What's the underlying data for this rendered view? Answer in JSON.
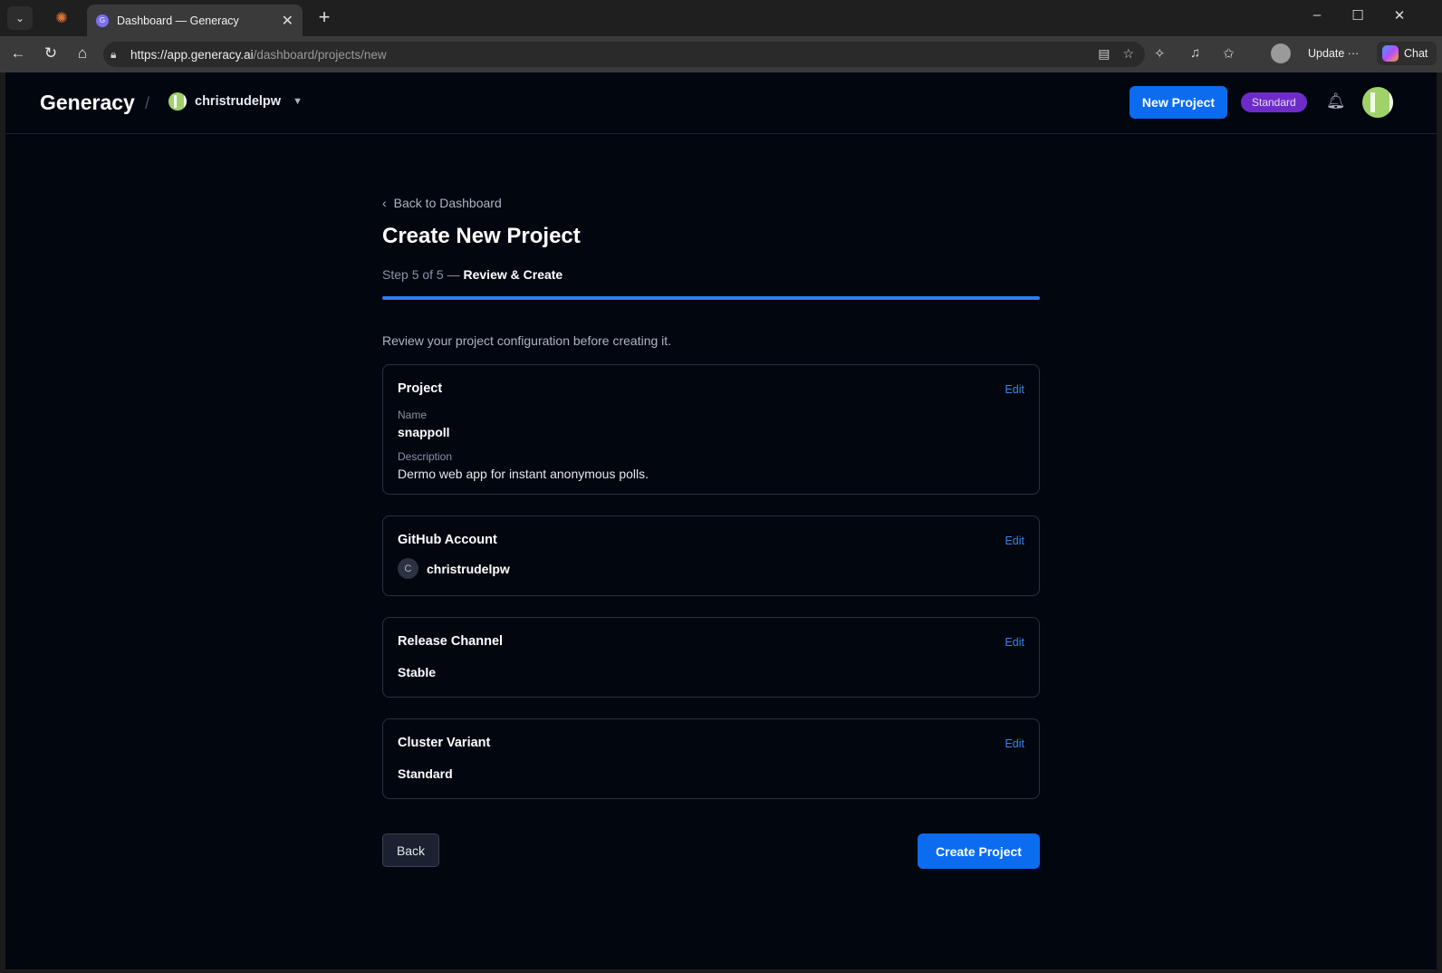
{
  "browser": {
    "tab_title": "Dashboard — Generacy",
    "tab_favicon_letter": "G",
    "url_host": "https://app.generacy.ai",
    "url_path": "/dashboard/projects/new",
    "update_label": "Update",
    "chat_label": "Chat"
  },
  "header": {
    "brand": "Generacy",
    "org_name": "christrudelpw",
    "new_project_label": "New Project",
    "plan_badge": "Standard"
  },
  "page": {
    "back_link": "Back to Dashboard",
    "title": "Create New Project",
    "step_prefix": "Step 5 of 5 — ",
    "step_name": "Review & Create",
    "progress_fraction": 1.0,
    "intro": "Review your project configuration before creating it."
  },
  "cards": {
    "project": {
      "title": "Project",
      "edit_label": "Edit",
      "name_label": "Name",
      "name_value": "snappoll",
      "description_label": "Description",
      "description_value": "Dermo web app for instant anonymous polls."
    },
    "github": {
      "title": "GitHub Account",
      "edit_label": "Edit",
      "avatar_letter": "C",
      "account_name": "christrudelpw"
    },
    "release": {
      "title": "Release Channel",
      "edit_label": "Edit",
      "value": "Stable"
    },
    "cluster": {
      "title": "Cluster Variant",
      "edit_label": "Edit",
      "value": "Standard"
    }
  },
  "actions": {
    "back_label": "Back",
    "create_label": "Create Project"
  },
  "colors": {
    "accent": "#0b6cf0",
    "plan_badge_bg": "#6d2cc9",
    "app_bg": "#02060f"
  }
}
